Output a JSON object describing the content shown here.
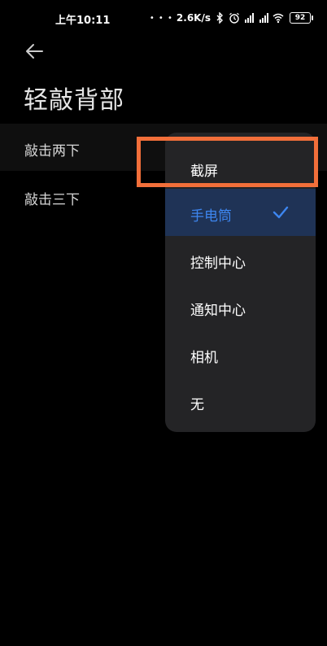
{
  "status_bar": {
    "time": "上午10:11",
    "dots": "• • •",
    "network_speed": "2.6K/s",
    "battery": "92",
    "icons": [
      "bluetooth-icon",
      "alarm-icon",
      "signal-hd-icon",
      "signal-hd-icon",
      "wifi-icon",
      "battery-icon"
    ]
  },
  "header": {
    "back_icon": "arrow-left-icon",
    "title": "轻敲背部"
  },
  "list": {
    "items": [
      {
        "label": "敲击两下"
      },
      {
        "label": "敲击三下"
      }
    ]
  },
  "dropdown": {
    "options": [
      {
        "label": "截屏",
        "selected": false
      },
      {
        "label": "手电筒",
        "selected": true
      },
      {
        "label": "控制中心",
        "selected": false
      },
      {
        "label": "通知中心",
        "selected": false
      },
      {
        "label": "相机",
        "selected": false
      },
      {
        "label": "无",
        "selected": false
      }
    ],
    "selected_color": "#3d86f0",
    "selected_bg": "#1f3356"
  },
  "highlight": {
    "color": "#f26f3a"
  }
}
